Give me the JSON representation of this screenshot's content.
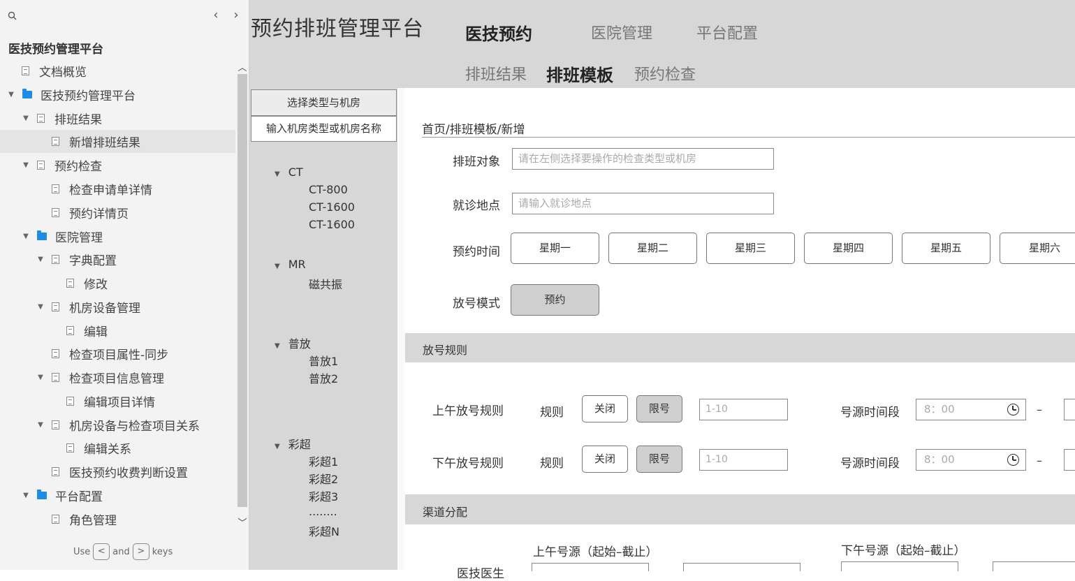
{
  "sidebar": {
    "site_title": "医技预约管理平台",
    "prev_arrow": "‹",
    "next_arrow": "›",
    "items": [
      {
        "label": "文档概览"
      },
      {
        "label": "医技预约管理平台"
      },
      {
        "label": "排班结果"
      },
      {
        "label": "新增排班结果"
      },
      {
        "label": "预约检查"
      },
      {
        "label": "检查申请单详情"
      },
      {
        "label": "预约详情页"
      },
      {
        "label": "医院管理"
      },
      {
        "label": "字典配置"
      },
      {
        "label": "修改"
      },
      {
        "label": "机房设备管理"
      },
      {
        "label": "编辑"
      },
      {
        "label": "检查项目属性-同步"
      },
      {
        "label": "检查项目信息管理"
      },
      {
        "label": "编辑项目详情"
      },
      {
        "label": "机房设备与检查项目关系"
      },
      {
        "label": "编辑关系"
      },
      {
        "label": "医技预约收费判断设置"
      },
      {
        "label": "平台配置"
      },
      {
        "label": "角色管理"
      }
    ],
    "hint": {
      "use": "Use",
      "and": "and",
      "keys": "keys",
      "key_prev": "<",
      "key_next": ">"
    }
  },
  "header": {
    "app_title": "预约排班管理平台",
    "top_nav": [
      "医技预约",
      "医院管理",
      "平台配置"
    ],
    "sub_nav": [
      "排班结果",
      "排班模板",
      "预约检查"
    ]
  },
  "room_panel": {
    "title": "选择类型与机房",
    "search_text": "输入机房类型或机房名称",
    "groups": [
      {
        "name": "CT",
        "rooms": [
          "CT-800",
          "CT-1600",
          "CT-1600"
        ]
      },
      {
        "name": "MR",
        "rooms": [
          "磁共振"
        ]
      },
      {
        "name": "普放",
        "rooms": [
          "普放1",
          "普放2"
        ]
      },
      {
        "name": "彩超",
        "rooms": [
          "彩超1",
          "彩超2",
          "彩超3",
          "........",
          "彩超N"
        ]
      }
    ]
  },
  "form": {
    "breadcrumb": "首页/排班模板/新增",
    "target_label": "排班对象",
    "target_placeholder": "请在左侧选择要操作的检查类型或机房",
    "location_label": "就诊地点",
    "location_placeholder": "请输入就诊地点",
    "time_label": "预约时间",
    "days": [
      "星期一",
      "星期二",
      "星期三",
      "星期四",
      "星期五",
      "星期六"
    ],
    "mode_label": "放号模式",
    "mode_value": "预约"
  },
  "rules": {
    "section_title": "放号规则",
    "rows": [
      {
        "label": "上午放号规则",
        "rule_label": "规则",
        "off": "关闭",
        "limit": "限号",
        "limit_placeholder": "1-10",
        "period_label": "号源时间段",
        "start": "8：00",
        "dash": "–"
      },
      {
        "label": "下午放号规则",
        "rule_label": "规则",
        "off": "关闭",
        "limit": "限号",
        "limit_placeholder": "1-10",
        "period_label": "号源时间段",
        "start": "8：00",
        "dash": "–"
      }
    ]
  },
  "channels": {
    "section_title": "渠道分配",
    "am_header": "上午号源（起始–截止）",
    "pm_header": "下午号源（起始–截止）",
    "row_label": "医技医生"
  }
}
